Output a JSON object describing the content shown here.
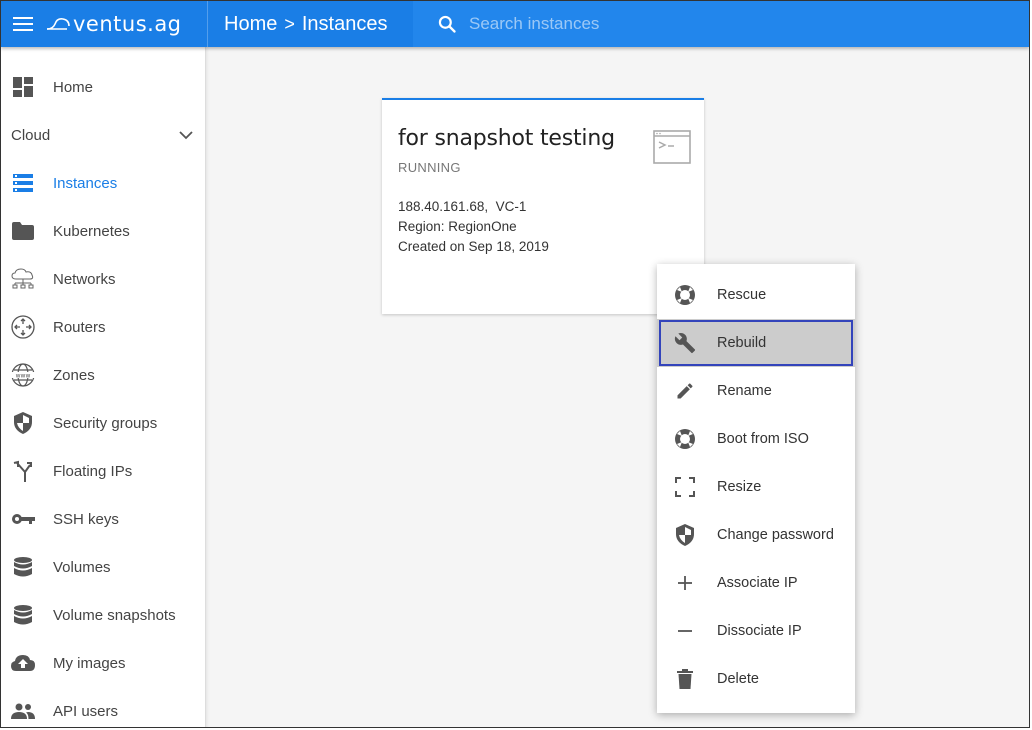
{
  "header": {
    "logo_text": "ventus.ag",
    "breadcrumb": {
      "home": "Home",
      "separator": ">",
      "current": "Instances"
    },
    "search_placeholder": "Search instances"
  },
  "sidebar": {
    "items": [
      {
        "label": "Home",
        "icon": "dashboard-icon"
      },
      {
        "label": "Instances",
        "icon": "server-list-icon",
        "active": true
      },
      {
        "label": "Kubernetes",
        "icon": "folder-icon"
      },
      {
        "label": "Networks",
        "icon": "cloud-network-icon"
      },
      {
        "label": "Routers",
        "icon": "router-icon"
      },
      {
        "label": "Zones",
        "icon": "www-globe-icon"
      },
      {
        "label": "Security groups",
        "icon": "shield-icon"
      },
      {
        "label": "Floating IPs",
        "icon": "fork-arrows-icon"
      },
      {
        "label": "SSH keys",
        "icon": "key-icon"
      },
      {
        "label": "Volumes",
        "icon": "database-icon"
      },
      {
        "label": "Volume snapshots",
        "icon": "database-icon"
      },
      {
        "label": "My images",
        "icon": "cloud-upload-icon"
      },
      {
        "label": "API users",
        "icon": "people-icon"
      }
    ],
    "section_label": "Cloud"
  },
  "card": {
    "title": "for snapshot testing",
    "status": "RUNNING",
    "ip_line": "188.40.161.68,  VC-1",
    "region": "Region: RegionOne",
    "created": "Created on Sep 18, 2019"
  },
  "context_menu": {
    "items": [
      {
        "label": "Rescue",
        "icon": "lifebuoy-icon"
      },
      {
        "label": "Rebuild",
        "icon": "wrench-icon",
        "highlighted": true
      },
      {
        "label": "Rename",
        "icon": "pencil-icon"
      },
      {
        "label": "Boot from ISO",
        "icon": "lifebuoy-icon"
      },
      {
        "label": "Resize",
        "icon": "resize-corners-icon"
      },
      {
        "label": "Change password",
        "icon": "shield-icon"
      },
      {
        "label": "Associate IP",
        "icon": "plus-icon"
      },
      {
        "label": "Dissociate IP",
        "icon": "minus-icon"
      },
      {
        "label": "Delete",
        "icon": "trash-icon"
      }
    ]
  },
  "colors": {
    "accent": "#1a7ee6",
    "highlight_border": "#3344bb"
  }
}
